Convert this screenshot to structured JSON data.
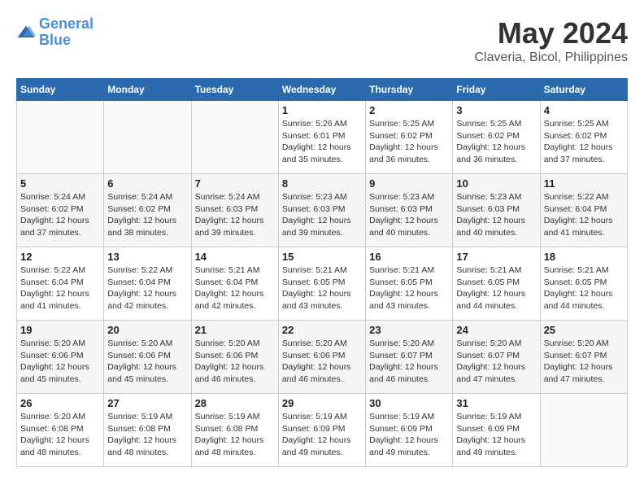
{
  "header": {
    "logo_line1": "General",
    "logo_line2": "Blue",
    "month_year": "May 2024",
    "location": "Claveria, Bicol, Philippines"
  },
  "days_of_week": [
    "Sunday",
    "Monday",
    "Tuesday",
    "Wednesday",
    "Thursday",
    "Friday",
    "Saturday"
  ],
  "weeks": [
    [
      {
        "day": "",
        "sunrise": "",
        "sunset": "",
        "daylight": ""
      },
      {
        "day": "",
        "sunrise": "",
        "sunset": "",
        "daylight": ""
      },
      {
        "day": "",
        "sunrise": "",
        "sunset": "",
        "daylight": ""
      },
      {
        "day": "1",
        "sunrise": "Sunrise: 5:26 AM",
        "sunset": "Sunset: 6:01 PM",
        "daylight": "Daylight: 12 hours and 35 minutes."
      },
      {
        "day": "2",
        "sunrise": "Sunrise: 5:25 AM",
        "sunset": "Sunset: 6:02 PM",
        "daylight": "Daylight: 12 hours and 36 minutes."
      },
      {
        "day": "3",
        "sunrise": "Sunrise: 5:25 AM",
        "sunset": "Sunset: 6:02 PM",
        "daylight": "Daylight: 12 hours and 36 minutes."
      },
      {
        "day": "4",
        "sunrise": "Sunrise: 5:25 AM",
        "sunset": "Sunset: 6:02 PM",
        "daylight": "Daylight: 12 hours and 37 minutes."
      }
    ],
    [
      {
        "day": "5",
        "sunrise": "Sunrise: 5:24 AM",
        "sunset": "Sunset: 6:02 PM",
        "daylight": "Daylight: 12 hours and 37 minutes."
      },
      {
        "day": "6",
        "sunrise": "Sunrise: 5:24 AM",
        "sunset": "Sunset: 6:02 PM",
        "daylight": "Daylight: 12 hours and 38 minutes."
      },
      {
        "day": "7",
        "sunrise": "Sunrise: 5:24 AM",
        "sunset": "Sunset: 6:03 PM",
        "daylight": "Daylight: 12 hours and 39 minutes."
      },
      {
        "day": "8",
        "sunrise": "Sunrise: 5:23 AM",
        "sunset": "Sunset: 6:03 PM",
        "daylight": "Daylight: 12 hours and 39 minutes."
      },
      {
        "day": "9",
        "sunrise": "Sunrise: 5:23 AM",
        "sunset": "Sunset: 6:03 PM",
        "daylight": "Daylight: 12 hours and 40 minutes."
      },
      {
        "day": "10",
        "sunrise": "Sunrise: 5:23 AM",
        "sunset": "Sunset: 6:03 PM",
        "daylight": "Daylight: 12 hours and 40 minutes."
      },
      {
        "day": "11",
        "sunrise": "Sunrise: 5:22 AM",
        "sunset": "Sunset: 6:04 PM",
        "daylight": "Daylight: 12 hours and 41 minutes."
      }
    ],
    [
      {
        "day": "12",
        "sunrise": "Sunrise: 5:22 AM",
        "sunset": "Sunset: 6:04 PM",
        "daylight": "Daylight: 12 hours and 41 minutes."
      },
      {
        "day": "13",
        "sunrise": "Sunrise: 5:22 AM",
        "sunset": "Sunset: 6:04 PM",
        "daylight": "Daylight: 12 hours and 42 minutes."
      },
      {
        "day": "14",
        "sunrise": "Sunrise: 5:21 AM",
        "sunset": "Sunset: 6:04 PM",
        "daylight": "Daylight: 12 hours and 42 minutes."
      },
      {
        "day": "15",
        "sunrise": "Sunrise: 5:21 AM",
        "sunset": "Sunset: 6:05 PM",
        "daylight": "Daylight: 12 hours and 43 minutes."
      },
      {
        "day": "16",
        "sunrise": "Sunrise: 5:21 AM",
        "sunset": "Sunset: 6:05 PM",
        "daylight": "Daylight: 12 hours and 43 minutes."
      },
      {
        "day": "17",
        "sunrise": "Sunrise: 5:21 AM",
        "sunset": "Sunset: 6:05 PM",
        "daylight": "Daylight: 12 hours and 44 minutes."
      },
      {
        "day": "18",
        "sunrise": "Sunrise: 5:21 AM",
        "sunset": "Sunset: 6:05 PM",
        "daylight": "Daylight: 12 hours and 44 minutes."
      }
    ],
    [
      {
        "day": "19",
        "sunrise": "Sunrise: 5:20 AM",
        "sunset": "Sunset: 6:06 PM",
        "daylight": "Daylight: 12 hours and 45 minutes."
      },
      {
        "day": "20",
        "sunrise": "Sunrise: 5:20 AM",
        "sunset": "Sunset: 6:06 PM",
        "daylight": "Daylight: 12 hours and 45 minutes."
      },
      {
        "day": "21",
        "sunrise": "Sunrise: 5:20 AM",
        "sunset": "Sunset: 6:06 PM",
        "daylight": "Daylight: 12 hours and 46 minutes."
      },
      {
        "day": "22",
        "sunrise": "Sunrise: 5:20 AM",
        "sunset": "Sunset: 6:06 PM",
        "daylight": "Daylight: 12 hours and 46 minutes."
      },
      {
        "day": "23",
        "sunrise": "Sunrise: 5:20 AM",
        "sunset": "Sunset: 6:07 PM",
        "daylight": "Daylight: 12 hours and 46 minutes."
      },
      {
        "day": "24",
        "sunrise": "Sunrise: 5:20 AM",
        "sunset": "Sunset: 6:07 PM",
        "daylight": "Daylight: 12 hours and 47 minutes."
      },
      {
        "day": "25",
        "sunrise": "Sunrise: 5:20 AM",
        "sunset": "Sunset: 6:07 PM",
        "daylight": "Daylight: 12 hours and 47 minutes."
      }
    ],
    [
      {
        "day": "26",
        "sunrise": "Sunrise: 5:20 AM",
        "sunset": "Sunset: 6:08 PM",
        "daylight": "Daylight: 12 hours and 48 minutes."
      },
      {
        "day": "27",
        "sunrise": "Sunrise: 5:19 AM",
        "sunset": "Sunset: 6:08 PM",
        "daylight": "Daylight: 12 hours and 48 minutes."
      },
      {
        "day": "28",
        "sunrise": "Sunrise: 5:19 AM",
        "sunset": "Sunset: 6:08 PM",
        "daylight": "Daylight: 12 hours and 48 minutes."
      },
      {
        "day": "29",
        "sunrise": "Sunrise: 5:19 AM",
        "sunset": "Sunset: 6:09 PM",
        "daylight": "Daylight: 12 hours and 49 minutes."
      },
      {
        "day": "30",
        "sunrise": "Sunrise: 5:19 AM",
        "sunset": "Sunset: 6:09 PM",
        "daylight": "Daylight: 12 hours and 49 minutes."
      },
      {
        "day": "31",
        "sunrise": "Sunrise: 5:19 AM",
        "sunset": "Sunset: 6:09 PM",
        "daylight": "Daylight: 12 hours and 49 minutes."
      },
      {
        "day": "",
        "sunrise": "",
        "sunset": "",
        "daylight": ""
      }
    ]
  ]
}
